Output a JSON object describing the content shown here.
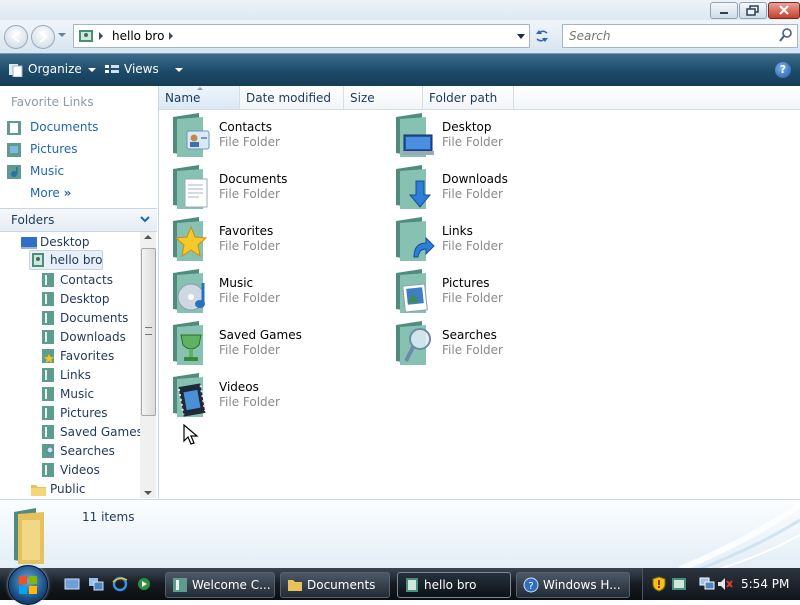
{
  "window": {
    "address": {
      "segment": "hello bro"
    },
    "search": {
      "placeholder": "Search"
    }
  },
  "toolbar": {
    "organize_label": "Organize",
    "views_label": "Views"
  },
  "nav": {
    "favorites_header": "Favorite Links",
    "favorites": [
      {
        "label": "Documents",
        "icon": "documents-folder-icon"
      },
      {
        "label": "Pictures",
        "icon": "pictures-folder-icon"
      },
      {
        "label": "Music",
        "icon": "music-folder-icon"
      }
    ],
    "more_label": "More",
    "more_suffix": "»",
    "folders_header": "Folders",
    "tree": [
      {
        "label": "Desktop"
      },
      {
        "label": "hello bro"
      },
      {
        "label": "Contacts"
      },
      {
        "label": "Desktop"
      },
      {
        "label": "Documents"
      },
      {
        "label": "Downloads"
      },
      {
        "label": "Favorites"
      },
      {
        "label": "Links"
      },
      {
        "label": "Music"
      },
      {
        "label": "Pictures"
      },
      {
        "label": "Saved Games"
      },
      {
        "label": "Searches"
      },
      {
        "label": "Videos"
      },
      {
        "label": "Public"
      }
    ]
  },
  "columns": [
    "Name",
    "Date modified",
    "Size",
    "Folder path"
  ],
  "files": [
    {
      "name": "Contacts",
      "type": "File Folder"
    },
    {
      "name": "Desktop",
      "type": "File Folder"
    },
    {
      "name": "Documents",
      "type": "File Folder"
    },
    {
      "name": "Downloads",
      "type": "File Folder"
    },
    {
      "name": "Favorites",
      "type": "File Folder"
    },
    {
      "name": "Links",
      "type": "File Folder"
    },
    {
      "name": "Music",
      "type": "File Folder"
    },
    {
      "name": "Pictures",
      "type": "File Folder"
    },
    {
      "name": "Saved Games",
      "type": "File Folder"
    },
    {
      "name": "Searches",
      "type": "File Folder"
    },
    {
      "name": "Videos",
      "type": "File Folder"
    }
  ],
  "details": {
    "item_count": "11 items"
  },
  "taskbar": {
    "buttons": [
      {
        "label": "Welcome C..."
      },
      {
        "label": "Documents"
      },
      {
        "label": "hello bro"
      },
      {
        "label": "Windows H..."
      }
    ],
    "clock": "5:54 PM"
  },
  "colors": {
    "toolbar": "#1c4a69",
    "link": "#1f65b5",
    "taskbar": "#151b22",
    "folder_teal": "#5e9c8e"
  }
}
